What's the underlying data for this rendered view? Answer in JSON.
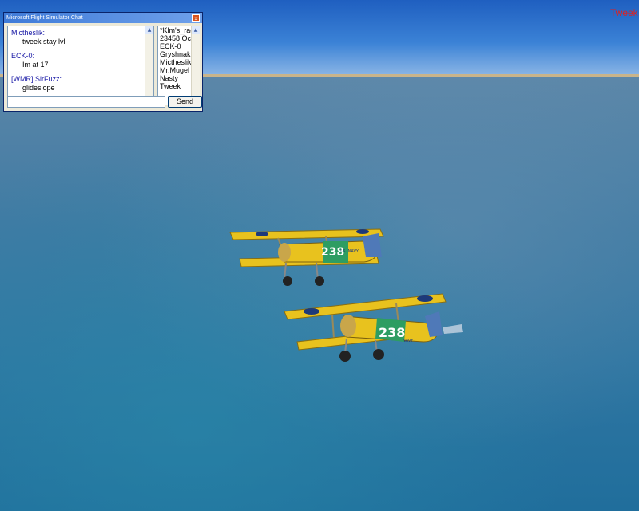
{
  "chat_window": {
    "title": "Microsoft Flight Simulator Chat",
    "close_glyph": "×",
    "messages": [
      {
        "sender": "Mictheslik:",
        "text": "tweek stay lvl"
      },
      {
        "sender": "ECK-0:",
        "text": "Im at 17"
      },
      {
        "sender": "[WMR] SirFuzz:",
        "text": "glideslope"
      }
    ],
    "users": [
      "*Klm's_rad",
      "23458 Ocea",
      "ECK-0",
      "Gryshnak",
      "Mictheslik",
      "Mr.Mugel",
      "Nasty",
      "Tweek"
    ],
    "input_value": "",
    "send_label": "Send"
  },
  "player_label": "Tweek",
  "aircraft": [
    {
      "number": "238",
      "marking": "U.S. NAVY"
    },
    {
      "number": "238",
      "marking": "NAVY"
    }
  ],
  "colors": {
    "sky": "#3b82d6",
    "sea": "#2f76a2",
    "horizon": "#c9b48a",
    "wing": "#e8c21e",
    "fuselage_band": "#2e9d62",
    "player_label": "#e02020"
  }
}
